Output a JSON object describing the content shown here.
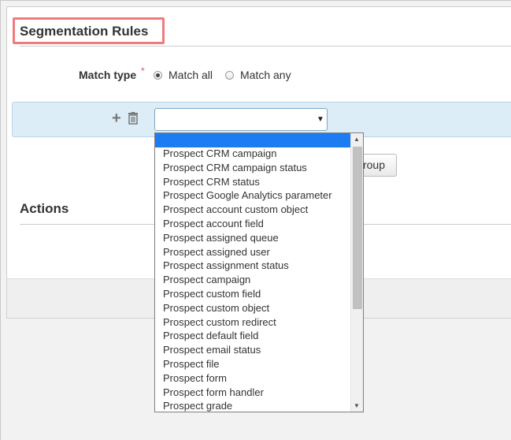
{
  "segmentation": {
    "title": "Segmentation Rules",
    "match_type_label": "Match type",
    "required_star": "*",
    "options": [
      {
        "label": "Match all",
        "selected": true
      },
      {
        "label": "Match any",
        "selected": false
      }
    ]
  },
  "rule": {
    "add_icon": "plus-icon",
    "delete_icon": "trash-icon",
    "select_value": "",
    "partial_button_label": "roup"
  },
  "actions": {
    "title": "Actions"
  },
  "dropdown": {
    "highlighted_value": "",
    "options": [
      "Prospect CRM campaign",
      "Prospect CRM campaign status",
      "Prospect CRM status",
      "Prospect Google Analytics parameter",
      "Prospect account custom object",
      "Prospect account field",
      "Prospect assigned queue",
      "Prospect assigned user",
      "Prospect assignment status",
      "Prospect campaign",
      "Prospect custom field",
      "Prospect custom object",
      "Prospect custom redirect",
      "Prospect default field",
      "Prospect email status",
      "Prospect file",
      "Prospect form",
      "Prospect form handler",
      "Prospect grade"
    ]
  },
  "colors": {
    "title_highlight": "#ef7b7e",
    "rule_row_bg": "#dcedf7",
    "dropdown_highlight": "#1e7cf2",
    "required_star": "#e05656"
  }
}
